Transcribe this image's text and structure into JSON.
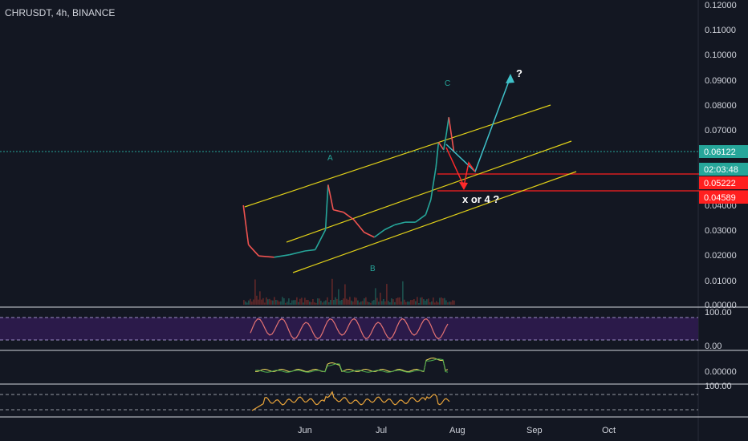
{
  "header": {
    "symbol_line": "CHRUSDT, 4h, BINANCE"
  },
  "colors": {
    "background": "#131722",
    "axis_text": "#d1d4dc",
    "grid": "#1e222d",
    "channel": "#e0d018",
    "price_up": "#26a69a",
    "price_down": "#ef5350",
    "current_price_line": "#26a69a",
    "level_line": "#ff1f1f",
    "projection_teal": "#3fc1c9",
    "projection_red": "#ff2a2a",
    "rsi_band": "#2b1a4a",
    "rsi_line": "#e57373",
    "osc_line": "#e8a33a",
    "macd_line": "#f6e05e",
    "signal_line": "#4caf50"
  },
  "chart_data": {
    "type": "line",
    "title": "CHRUSDT, 4h, BINANCE",
    "x": [
      "2020-05-08",
      "2020-05-10",
      "2020-05-14",
      "2020-05-20",
      "2020-05-26",
      "2020-06-01",
      "2020-06-05",
      "2020-06-09",
      "2020-06-10",
      "2020-06-12",
      "2020-06-16",
      "2020-06-20",
      "2020-06-24",
      "2020-06-28",
      "2020-07-02",
      "2020-07-06",
      "2020-07-10",
      "2020-07-14",
      "2020-07-18",
      "2020-07-20",
      "2020-07-22",
      "2020-07-23",
      "2020-07-25",
      "2020-07-26",
      "2020-07-27",
      "2020-07-28",
      "2020-07-29"
    ],
    "series": [
      {
        "values": [
          0.0398,
          0.024,
          0.0195,
          0.019,
          0.02,
          0.0215,
          0.022,
          0.03,
          0.048,
          0.038,
          0.037,
          0.034,
          0.029,
          0.027,
          0.03,
          0.032,
          0.033,
          0.033,
          0.036,
          0.042,
          0.055,
          0.065,
          0.062,
          0.068,
          0.075,
          0.068,
          0.0612
        ]
      }
    ],
    "price_axis": {
      "ticks": [
        "0.12000",
        "0.11000",
        "0.10000",
        "0.09000",
        "0.08000",
        "0.07000",
        "0.04000",
        "0.03000",
        "0.02000",
        "0.01000",
        "0.00000"
      ],
      "ylim": [
        0.0,
        0.12
      ]
    },
    "time_axis": {
      "ticks": [
        "Jun",
        "Jul",
        "Aug",
        "Sep",
        "Oct"
      ]
    },
    "price_labels": {
      "current": "0.06122",
      "countdown": "02:03:48",
      "level_1": "0.05222",
      "level_2": "0.04589"
    },
    "annotations": {
      "wave_a": "A",
      "wave_b": "B",
      "wave_c": "C",
      "question": "?",
      "x_or_4": "x or 4 ?"
    },
    "rsi": {
      "ticks": [
        "100.00",
        "0.00"
      ],
      "ylim": [
        0,
        100
      ]
    },
    "macd": {
      "ticks": [
        "0.00000"
      ]
    },
    "oscillator": {
      "ticks": [
        "100.00"
      ]
    },
    "grid": false
  }
}
